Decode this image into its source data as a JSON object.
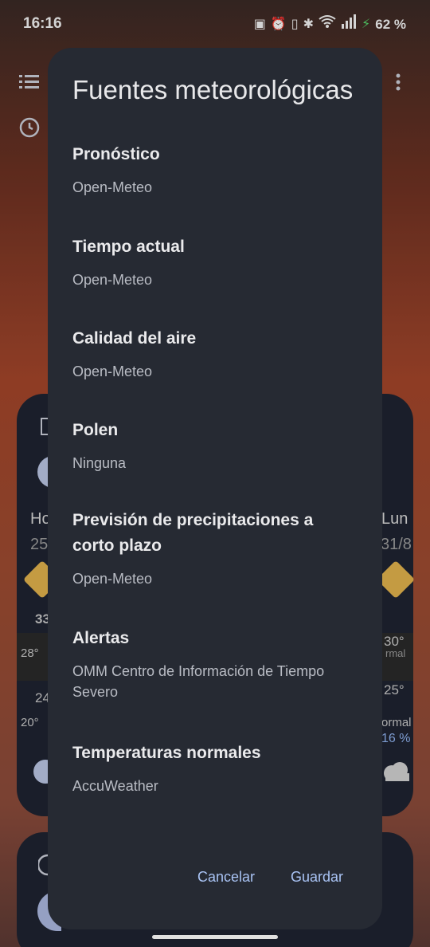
{
  "status_bar": {
    "time": "16:16",
    "battery": "62 %",
    "icons": [
      "nfc-icon",
      "alarm-icon",
      "vibrate-icon",
      "bluetooth-icon",
      "wifi-icon",
      "signal-icon",
      "charging-icon"
    ]
  },
  "background": {
    "left_day_label": "Ho",
    "left_date": "25",
    "right_day_label": "Lun",
    "right_date": "31/8",
    "left_temp_high": "33",
    "left_temp_mid": "28°",
    "left_temp_low": "24",
    "left_temp_min": "20°",
    "right_temp_high": "30°",
    "right_normal": "rmal",
    "right_temp_low": "25°",
    "right_normal2": "ormal",
    "right_percent": "16 %"
  },
  "dialog": {
    "title": "Fuentes meteorológicas",
    "sources": [
      {
        "title": "Pronóstico",
        "value": "Open-Meteo"
      },
      {
        "title": "Tiempo actual",
        "value": "Open-Meteo"
      },
      {
        "title": "Calidad del aire",
        "value": "Open-Meteo"
      },
      {
        "title": "Polen",
        "value": "Ninguna"
      },
      {
        "title": "Previsión de precipitaciones a corto plazo",
        "value": "Open-Meteo"
      },
      {
        "title": "Alertas",
        "value": "OMM Centro de Información de Tiempo Severo"
      },
      {
        "title": "Temperaturas normales",
        "value": "AccuWeather"
      }
    ],
    "cancel_label": "Cancelar",
    "save_label": "Guardar"
  },
  "colors": {
    "dialog_bg": "#262a33",
    "accent": "#a9c3f4",
    "card_bg": "#1e2330"
  }
}
